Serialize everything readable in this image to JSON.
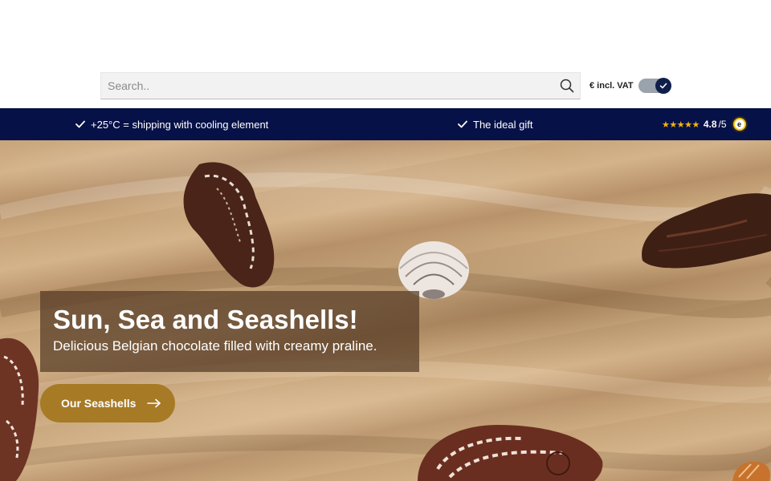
{
  "search": {
    "placeholder": "Search.."
  },
  "vat_toggle": {
    "label": "€ incl. VAT",
    "checked": true
  },
  "usp_bar": {
    "items": [
      {
        "icon": "check-icon",
        "text": "+25°C = shipping with cooling element"
      },
      {
        "icon": "check-icon",
        "text": "The ideal gift"
      }
    ],
    "rating": {
      "stars": "★★★★★",
      "score": "4.8",
      "max": "/5",
      "badge_icon": "trusted-shops-badge-icon",
      "badge_letter": "e"
    }
  },
  "hero": {
    "headline": "Sun, Sea and Seashells!",
    "subheadline": "Delicious Belgian chocolate filled with creamy praline.",
    "cta_label": "Our Seashells",
    "cta_icon": "arrow-right-icon"
  },
  "colors": {
    "usp_bar_bg": "#061147",
    "cta_bg": "#a77a25",
    "star": "#f5b50a",
    "toggle_knob": "#0f1f4a"
  }
}
